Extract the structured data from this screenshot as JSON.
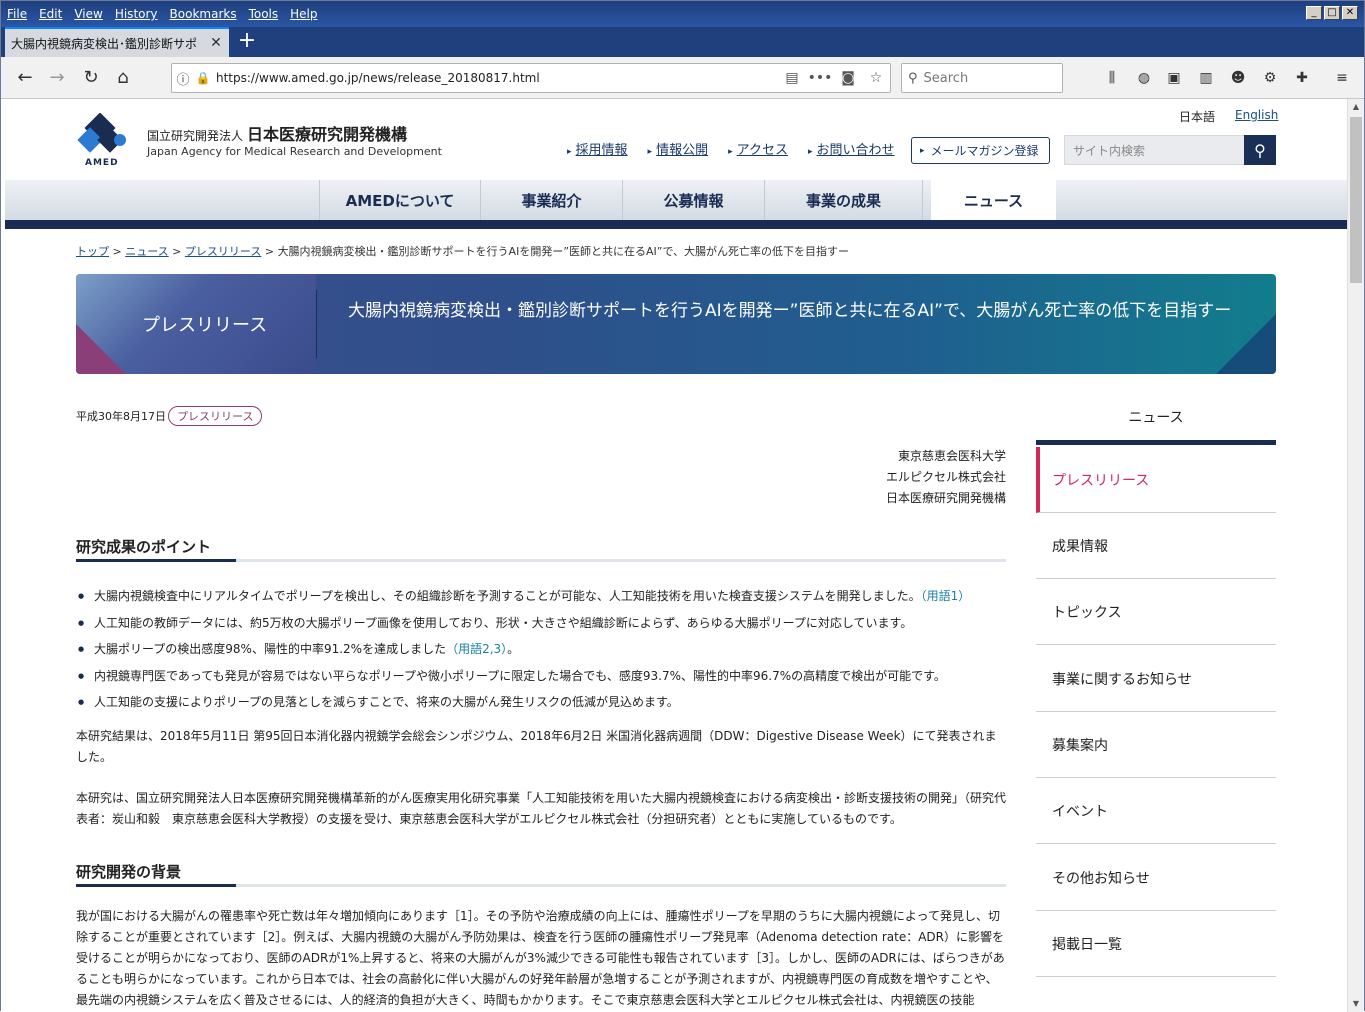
{
  "browser": {
    "menu": [
      "File",
      "Edit",
      "View",
      "History",
      "Bookmarks",
      "Tools",
      "Help"
    ],
    "tab_title": "大腸内視鏡病変検出･鑑別診断サポ",
    "url": "https://www.amed.go.jp/news/release_20180817.html",
    "search_placeholder": "Search"
  },
  "header": {
    "logo_sub": "AMED",
    "org_type": "国立研究開発法人",
    "org_name": "日本医療研究開発機構",
    "org_en": "Japan Agency for Medical Research and Development",
    "lang_ja": "日本語",
    "lang_en": "English",
    "links": [
      "採用情報",
      "情報公開",
      "アクセス",
      "お問い合わせ"
    ],
    "mail_button": "メールマガジン登録",
    "search_placeholder": "サイト内検索"
  },
  "gnav": [
    "AMEDについて",
    "事業紹介",
    "公募情報",
    "事業の成果",
    "ニュース"
  ],
  "breadcrumb": {
    "top": "トップ",
    "news": "ニュース",
    "release": "プレスリリース",
    "current": "大腸内視鏡病変検出・鑑別診断サポートを行うAIを開発ー”医師と共に在るAI”で、大腸がん死亡率の低下を目指すー"
  },
  "banner": {
    "label": "プレスリリース",
    "title": "大腸内視鏡病変検出・鑑別診断サポートを行うAIを開発ー”医師と共に在るAI”で、大腸がん死亡率の低下を目指すー"
  },
  "article": {
    "date": "平成30年8月17日",
    "badge": "プレスリリース",
    "orgs": [
      "東京慈恵会医科大学",
      "エルピクセル株式会社",
      "日本医療研究開発機構"
    ],
    "h_points": "研究成果のポイント",
    "points": [
      {
        "text": "大腸内視鏡検査中にリアルタイムでポリープを検出し、その組織診断を予測することが可能な、人工知能技術を用いた検査支援システムを開発しました。",
        "term": "（用語1）",
        "tail": ""
      },
      {
        "text": "人工知能の教師データには、約5万枚の大腸ポリープ画像を使用しており、形状・大きさや組織診断によらず、あらゆる大腸ポリープに対応しています。",
        "term": "",
        "tail": ""
      },
      {
        "text": "大腸ポリープの検出感度98%、陽性的中率91.2%を達成しました",
        "term": "（用語2,3）",
        "tail": "。"
      },
      {
        "text": "内視鏡専門医であっても発見が容易ではない平らなポリープや微小ポリープに限定した場合でも、感度93.7%、陽性的中率96.7%の高精度で検出が可能です。",
        "term": "",
        "tail": ""
      },
      {
        "text": "人工知能の支援によりポリープの見落としを減らすことで、将来の大腸がん発生リスクの低減が見込めます。",
        "term": "",
        "tail": ""
      }
    ],
    "p1": "本研究結果は、2018年5月11日 第95回日本消化器内視鏡学会総会シンポジウム、2018年6月2日 米国消化器病週間（DDW：Digestive Disease Week）にて発表されました。",
    "p2": "本研究は、国立研究開発法人日本医療研究開発機構革新的がん医療実用化研究事業「人工知能技術を用いた大腸内視鏡検査における病変検出・診断支援技術の開発」（研究代表者：炭山和毅　東京慈恵会医科大学教授）の支援を受け、東京慈恵会医科大学がエルピクセル株式会社（分担研究者）とともに実施しているものです。",
    "h_background": "研究開発の背景",
    "p3": "我が国における大腸がんの罹患率や死亡数は年々増加傾向にあります［1］。その予防や治療成績の向上には、腫瘍性ポリープを早期のうちに大腸内視鏡によって発見し、切除することが重要とされています［2］。例えば、大腸内視鏡の大腸がん予防効果は、検査を行う医師の腫瘍性ポリープ発見率（Adenoma detection rate：ADR）に影響を受けることが明らかになっており、医師のADRが1%上昇すると、将来の大腸がんが3%減少できる可能性も報告されています［3］。しかし、医師のADRには、ばらつきがあることも明らかになっています。これから日本では、社会の高齢化に伴い大腸がんの好発年齢層が急増することが予測されますが、内視鏡専門医の育成数を増やすことや、最先端の内視鏡システムを広く普及させるには、人的経済的負担が大きく、時間もかかります。そこで東京慈恵会医科大学とエルピクセル株式会社は、内視鏡医の技能"
  },
  "sidebar": {
    "head": "ニュース",
    "items": [
      "プレスリリース",
      "成果情報",
      "トピックス",
      "事業に関するお知らせ",
      "募集案内",
      "イベント",
      "その他お知らせ",
      "掲載日一覧"
    ]
  }
}
